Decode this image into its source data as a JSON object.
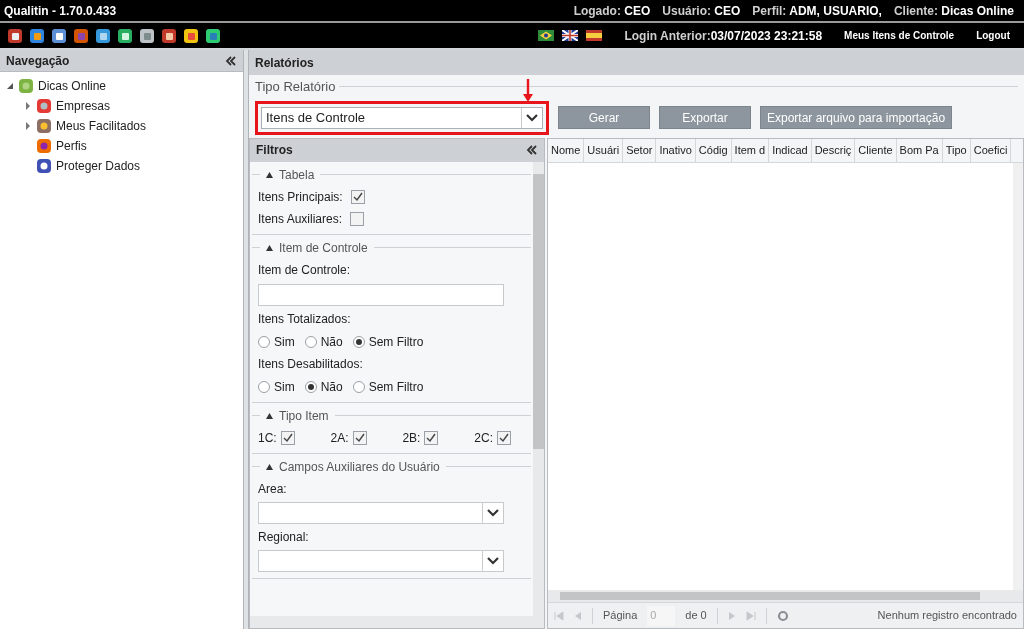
{
  "app": {
    "title": "Qualitin - 1.70.0.433",
    "session": [
      {
        "label": "Logado:",
        "value": "CEO"
      },
      {
        "label": "Usuário:",
        "value": "CEO"
      },
      {
        "label": "Perfil:",
        "value": "ADM, USUARIO,"
      },
      {
        "label": "Cliente:",
        "value": "Dicas Online"
      }
    ],
    "last_login": {
      "label": "Login Anterior:",
      "value": "03/07/2023 23:21:58"
    },
    "links": [
      "Meus Itens de Controle",
      "Logout"
    ]
  },
  "navigation": {
    "title": "Navegação",
    "tree": [
      {
        "label": "Dicas Online",
        "expanded": true,
        "children": [
          {
            "label": "Empresas",
            "expanded": false,
            "kind": "folder"
          },
          {
            "label": "Meus Facilitados",
            "expanded": false,
            "kind": "folder"
          },
          {
            "label": "Perfis",
            "kind": "leaf"
          },
          {
            "label": "Proteger Dados",
            "kind": "leaf"
          }
        ]
      }
    ]
  },
  "report": {
    "title": "Relatórios",
    "type_legend": "Tipo Relatório",
    "type_value": "Itens de Controle",
    "buttons": [
      "Gerar",
      "Exportar",
      "Exportar arquivo para importação"
    ]
  },
  "filters": {
    "title": "Filtros",
    "sections": [
      {
        "title": "Tabela",
        "expanded": true,
        "rows": [
          {
            "kind": "checkbox",
            "label": "Itens Principais:",
            "checked": true
          },
          {
            "kind": "checkbox",
            "label": "Itens Auxiliares:",
            "checked": false
          }
        ]
      },
      {
        "title": "Item de Controle",
        "expanded": true,
        "rows": [
          {
            "kind": "text",
            "label": "Item de Controle:"
          },
          {
            "kind": "radio",
            "label": "Itens Totalizados:",
            "options": [
              {
                "label": "Sim",
                "selected": false
              },
              {
                "label": "Não",
                "selected": false
              },
              {
                "label": "Sem Filtro",
                "selected": true
              }
            ]
          },
          {
            "kind": "radio",
            "label": "Itens Desabilitados:",
            "options": [
              {
                "label": "Sim",
                "selected": false
              },
              {
                "label": "Não",
                "selected": true
              },
              {
                "label": "Sem Filtro",
                "selected": false
              }
            ]
          }
        ]
      },
      {
        "title": "Tipo Item",
        "expanded": true,
        "rows": [
          {
            "kind": "checks",
            "items": [
              {
                "label": "1C:",
                "checked": true
              },
              {
                "label": "2A:",
                "checked": true
              },
              {
                "label": "2B:",
                "checked": true
              },
              {
                "label": "2C:",
                "checked": true
              }
            ]
          }
        ]
      },
      {
        "title": "Campos Auxiliares do Usuário",
        "expanded": true,
        "rows": [
          {
            "kind": "select",
            "label": "Area:"
          },
          {
            "kind": "select",
            "label": "Regional:"
          }
        ]
      }
    ]
  },
  "grid": {
    "columns": [
      "Nome",
      "Usuári",
      "Setor",
      "Inativo",
      "Códig",
      "Item d",
      "Indicad",
      "Descriç",
      "Cliente",
      "Bom Pa",
      "Tipo",
      "Coefici"
    ],
    "pager": {
      "page_label": "Página",
      "page_value": "0",
      "of": "de 0",
      "status": "Nenhum registro encontrado"
    }
  }
}
